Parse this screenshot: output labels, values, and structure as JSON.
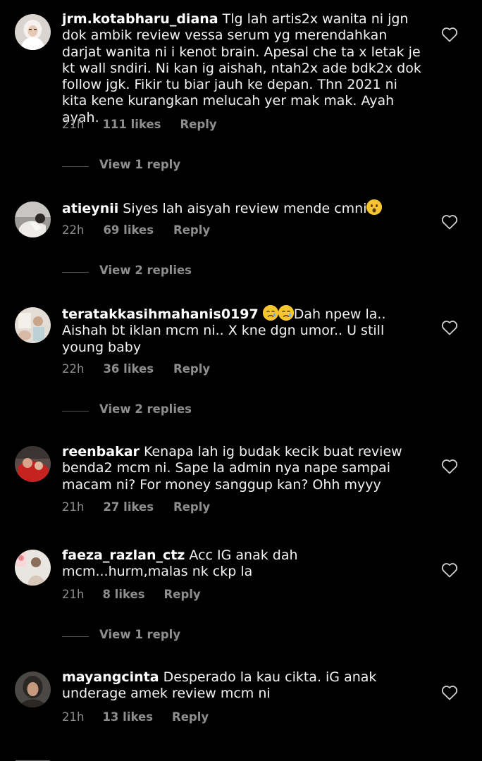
{
  "colors": {
    "background": "#000000",
    "text": "#f2f2f2",
    "muted": "#8e8e8e",
    "divider": "#555555"
  },
  "comments": [
    {
      "username": "jrm.kotabharu_diana",
      "text": "Tlg lah artis2x wanita ni jgn dok ambik review vessa serum yg merendahkan darjat wanita ni i kenot brain. Apesal che ta x letak je kt wall sndiri. Ni kan ig aishah, ntah2x ade bdk2x dok follow jgk. Fikir tu biar jauh ke depan. Thn 2021 ni kita kene kurangkan melucah yer mak mak. Ayah ayah.",
      "time": "21h",
      "likes": "111 likes",
      "reply": "Reply",
      "view_replies": "View 1 reply",
      "like_icon": "heart-outline-icon"
    },
    {
      "username": "atieynii",
      "text": "Siyes lah aisyah review mende cmni",
      "emoji": "hushed-face-emoji",
      "time": "22h",
      "likes": "69 likes",
      "reply": "Reply",
      "view_replies": "View 2 replies",
      "like_icon": "heart-outline-icon"
    },
    {
      "username": "teratakkasihmahanis0197",
      "emoji": "crying-face-emoji",
      "text": "Dah npew la.. Aishah bt iklan mcm ni.. X kne dgn umor.. U still young baby",
      "time": "22h",
      "likes": "36 likes",
      "reply": "Reply",
      "view_replies": "View 2 replies",
      "like_icon": "heart-outline-icon"
    },
    {
      "username": "reenbakar",
      "text": "Kenapa lah ig budak kecik buat review benda2 mcm ni. Sape la admin nya nape sampai macam ni? For money sanggup kan? Ohh myyy",
      "time": "21h",
      "likes": "27 likes",
      "reply": "Reply",
      "like_icon": "heart-outline-icon"
    },
    {
      "username": "faeza_razlan_ctz",
      "text": "Acc IG anak dah mcm...hurm,malas nk ckp la",
      "time": "21h",
      "likes": "8 likes",
      "reply": "Reply",
      "view_replies": "View 1 reply",
      "like_icon": "heart-outline-icon"
    },
    {
      "username": "mayangcinta",
      "text": "Desperado la kau cikta. iG anak underage amek review mcm ni",
      "time": "21h",
      "likes": "13 likes",
      "reply": "Reply",
      "like_icon": "heart-outline-icon"
    }
  ]
}
